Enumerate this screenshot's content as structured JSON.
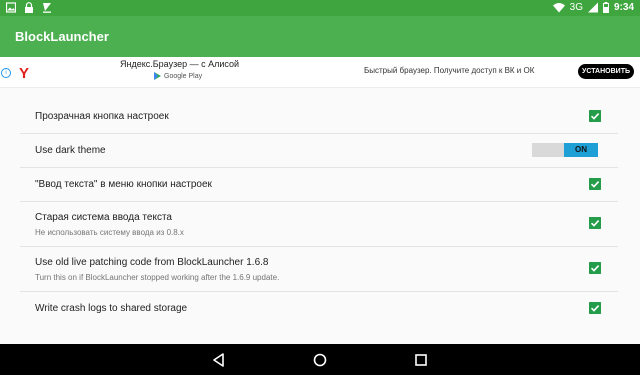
{
  "status_bar": {
    "network": "3G",
    "time": "9:34"
  },
  "app": {
    "title": "BlockLauncher",
    "accent": "#4caf50"
  },
  "ad": {
    "logo": "Y",
    "title": "Яндекс.Браузер — с Алисой",
    "store": "Google Play",
    "text": "Быстрый браузер. Получите доступ к ВК и ОК",
    "cta": "УСТАНОВИТЬ"
  },
  "settings": {
    "items": [
      {
        "title": "Прозрачная кнопка настроек",
        "control": "checkbox",
        "checked": true
      },
      {
        "title": "Use dark theme",
        "control": "toggle",
        "state": "ON"
      },
      {
        "title": "\"Ввод текста\" в меню кнопки настроек",
        "control": "checkbox",
        "checked": true
      },
      {
        "title": "Старая система ввода текста",
        "subtitle": "Не использовать систему ввода из 0.8.x",
        "control": "checkbox",
        "checked": true
      },
      {
        "title": "Use old live patching code from BlockLauncher 1.6.8",
        "subtitle": "Turn this on if BlockLauncher stopped working after the 1.6.9 update.",
        "control": "checkbox",
        "checked": true
      },
      {
        "title": "Write crash logs to shared storage",
        "control": "checkbox",
        "checked": true
      }
    ]
  },
  "icons": {
    "status_left": [
      "image-icon",
      "lock-icon",
      "download-icon"
    ],
    "status_right": [
      "wifi-icon",
      "signal-icon",
      "battery-icon"
    ],
    "nav": [
      "back-icon",
      "home-icon",
      "recents-icon"
    ]
  }
}
